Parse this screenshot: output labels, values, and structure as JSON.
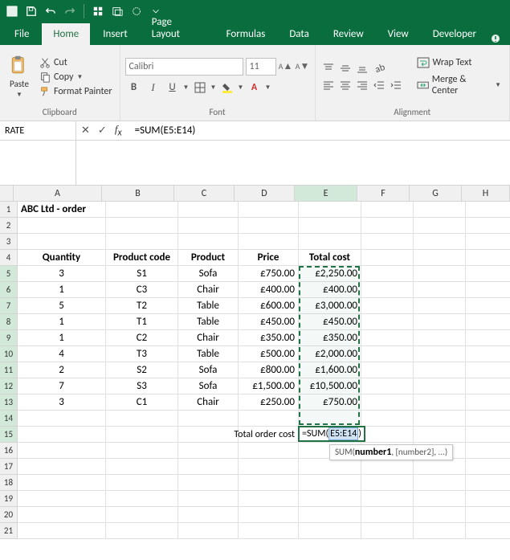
{
  "qat": {
    "save": "save-icon",
    "undo": "undo-icon",
    "redo": "redo-icon"
  },
  "tabs": {
    "file": "File",
    "home": "Home",
    "insert": "Insert",
    "page_layout": "Page Layout",
    "formulas": "Formulas",
    "data": "Data",
    "review": "Review",
    "view": "View",
    "developer": "Developer"
  },
  "ribbon": {
    "clipboard": {
      "label": "Clipboard",
      "paste": "Paste",
      "cut": "Cut",
      "copy": "Copy",
      "format_painter": "Format Painter"
    },
    "font": {
      "label": "Font",
      "name": "Calibri",
      "size": "11",
      "bold": "B",
      "italic": "I",
      "underline": "U"
    },
    "alignment": {
      "label": "Alignment",
      "wrap": "Wrap Text",
      "merge": "Merge & Center"
    }
  },
  "name_box": "RATE",
  "formula": "=SUM(E5:E14)",
  "columns": [
    "A",
    "B",
    "C",
    "D",
    "E",
    "F",
    "G",
    "H"
  ],
  "rows": [
    "1",
    "2",
    "3",
    "4",
    "5",
    "6",
    "7",
    "8",
    "9",
    "10",
    "11",
    "12",
    "13",
    "14",
    "15",
    "16",
    "17",
    "18",
    "19",
    "20",
    "21"
  ],
  "sheet": {
    "title": "ABC Ltd - order",
    "headers": {
      "qty": "Quantity",
      "code": "Product code",
      "product": "Product",
      "price": "Price",
      "total": "Total cost"
    },
    "data": [
      {
        "qty": "3",
        "code": "S1",
        "product": "Sofa",
        "price": "£750.00",
        "total": "£2,250.00"
      },
      {
        "qty": "1",
        "code": "C3",
        "product": "Chair",
        "price": "£400.00",
        "total": "£400.00"
      },
      {
        "qty": "5",
        "code": "T2",
        "product": "Table",
        "price": "£600.00",
        "total": "£3,000.00"
      },
      {
        "qty": "1",
        "code": "T1",
        "product": "Table",
        "price": "£450.00",
        "total": "£450.00"
      },
      {
        "qty": "1",
        "code": "C2",
        "product": "Chair",
        "price": "£350.00",
        "total": "£350.00"
      },
      {
        "qty": "4",
        "code": "T3",
        "product": "Table",
        "price": "£500.00",
        "total": "£2,000.00"
      },
      {
        "qty": "2",
        "code": "S2",
        "product": "Sofa",
        "price": "£800.00",
        "total": "£1,600.00"
      },
      {
        "qty": "7",
        "code": "S3",
        "product": "Sofa",
        "price": "£1,500.00",
        "total": "£10,500.00"
      },
      {
        "qty": "3",
        "code": "C1",
        "product": "Chair",
        "price": "£250.00",
        "total": "£750.00"
      }
    ],
    "total_label": "Total order cost",
    "editing_formula_prefix": "=SUM(",
    "editing_formula_range": "E5:E14",
    "editing_formula_suffix": ")",
    "tooltip_fn": "SUM(",
    "tooltip_arg1": "number1",
    "tooltip_rest": ", [number2], ...)"
  }
}
